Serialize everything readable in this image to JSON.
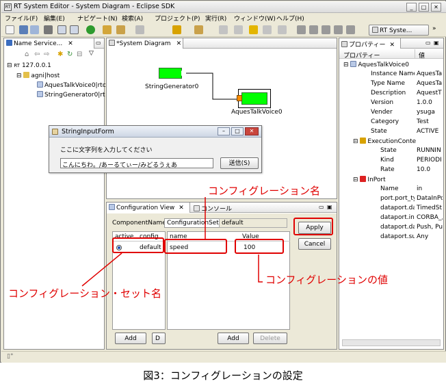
{
  "window": {
    "title": "RT System Editor - System Diagram - Eclipse SDK"
  },
  "menu": [
    "ファイル(F)",
    "編集(E)",
    "ナビゲート(N)",
    "検索(A)",
    "プロジェクト(P)",
    "実行(R)",
    "ウィンドウ(W)",
    "ヘルプ(H)"
  ],
  "toolbar": {
    "perspective": "RT Syste..."
  },
  "name_service": {
    "tab": "Name Service...",
    "tree": [
      "127.0.0.1",
      "agni|host",
      "AquesTalkVoice0|rtc",
      "StringGenerator0|rt"
    ],
    "root_prefix": "RT"
  },
  "diagram": {
    "tab": "*System Diagram",
    "components": [
      "StringGenerator0",
      "AquesTalkVoice0"
    ]
  },
  "dialog": {
    "title": "StringInputForm",
    "prompt": "ここに文字列を入力してください",
    "input": "こんにちわ。/あーるてぃー/みどるうぇあ",
    "send": "送信(S)"
  },
  "config_view": {
    "tab": "Configuration View",
    "console_tab": "コンソール",
    "component_name_label": "ComponentName",
    "config_set_label": "ConfigurationSet:",
    "config_set_value": "default",
    "col_active": "active",
    "col_config": "config",
    "config_name": "default",
    "col_name": "name",
    "col_value": "Value",
    "param_name": "speed",
    "param_value": "100",
    "apply": "Apply",
    "cancel": "Cancel",
    "add_left": "Add",
    "delete_left": "D",
    "add_right": "Add",
    "delete_right": "Delete"
  },
  "properties": {
    "tab": "プロパティー",
    "col_prop": "プロパティー",
    "col_val": "値",
    "rows": [
      {
        "k": "AquesTalkVoice0",
        "v": ""
      },
      {
        "k": "Instance Name",
        "v": "AquesTa"
      },
      {
        "k": "Type Name",
        "v": "AquesTa"
      },
      {
        "k": "Description",
        "v": "AquestT"
      },
      {
        "k": "Version",
        "v": "1.0.0"
      },
      {
        "k": "Vender",
        "v": "ysuga"
      },
      {
        "k": "Category",
        "v": "Test"
      },
      {
        "k": "State",
        "v": "ACTIVE"
      },
      {
        "k": "ExecutionConte",
        "v": ""
      },
      {
        "k": "State",
        "v": "RUNNIN"
      },
      {
        "k": "Kind",
        "v": "PERIODI"
      },
      {
        "k": "Rate",
        "v": "10.0"
      },
      {
        "k": "InPort",
        "v": ""
      },
      {
        "k": "Name",
        "v": "in"
      },
      {
        "k": "port.port_ty",
        "v": "DataInPo"
      },
      {
        "k": "dataport.da",
        "v": "TimedSt"
      },
      {
        "k": "dataport.int",
        "v": "CORBA_,"
      },
      {
        "k": "dataport.da",
        "v": "Push, Pu"
      },
      {
        "k": "dataport.su",
        "v": "Any"
      }
    ]
  },
  "annotations": {
    "config_name": "コンフィグレーション名",
    "config_value": "コンフィグレーションの値",
    "config_set_name": "コンフィグレーション・セット名"
  },
  "caption": "図3：コンフィグレーションの設定",
  "colors": {
    "annotation": "#e00000",
    "component": "#00ff00"
  }
}
